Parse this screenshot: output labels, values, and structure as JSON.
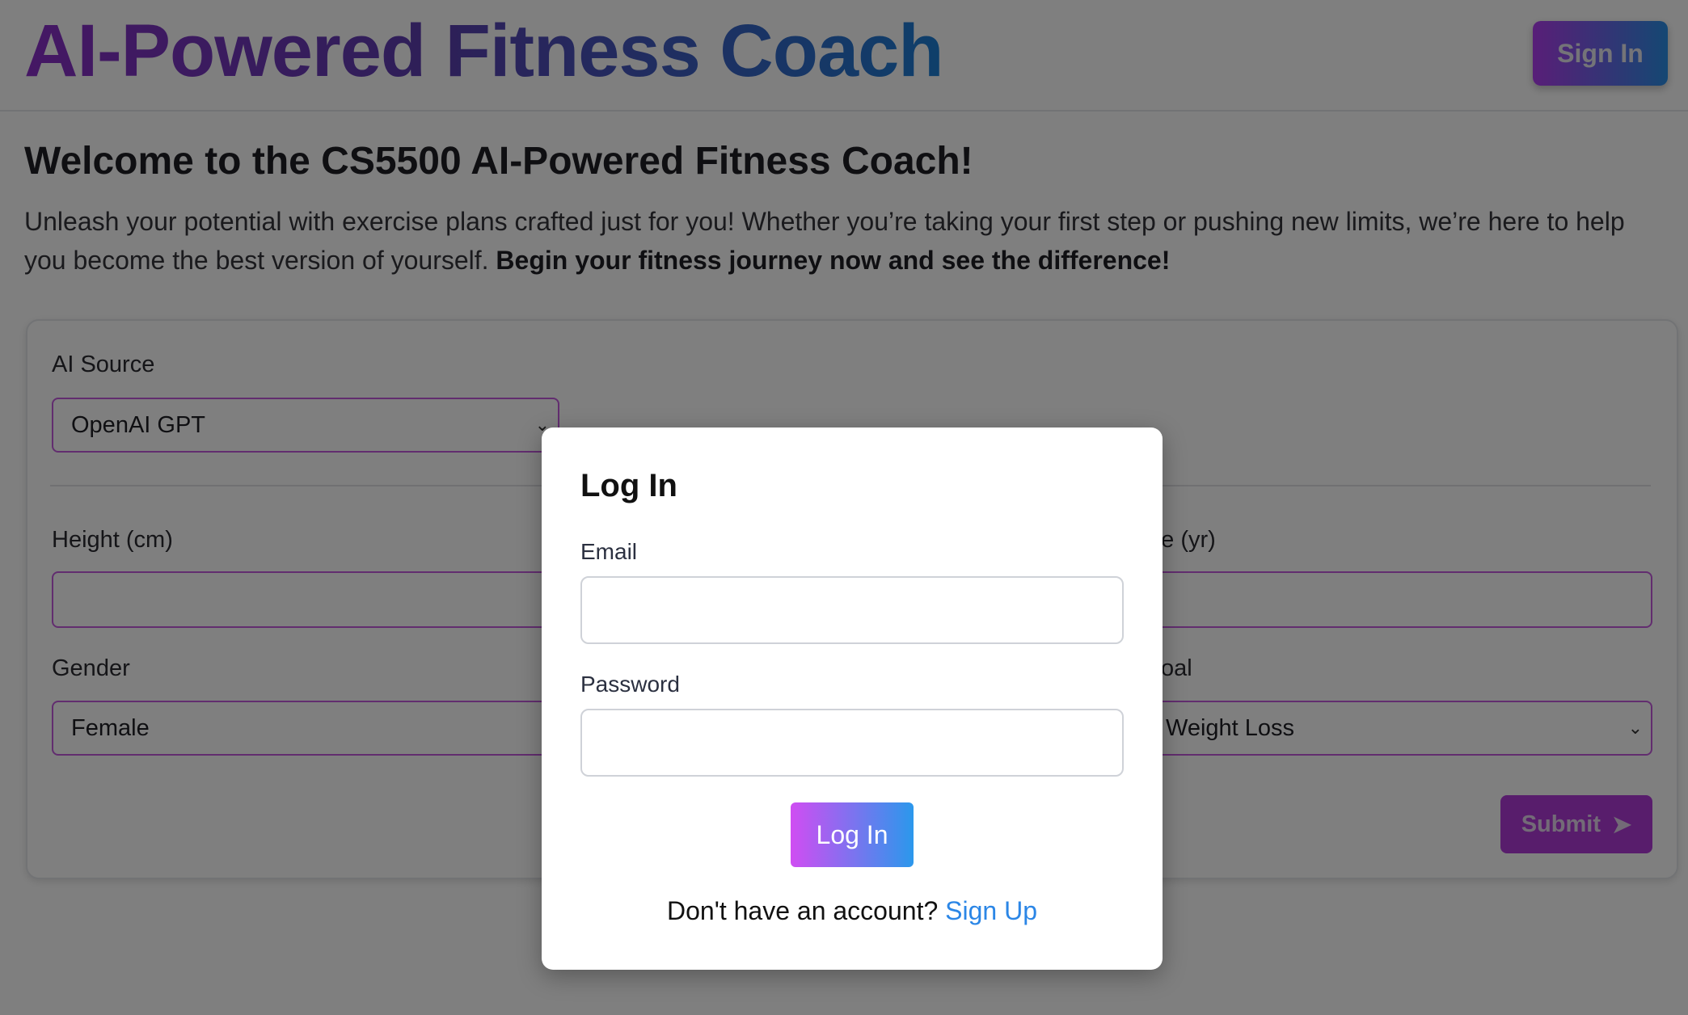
{
  "header": {
    "title": "AI-Powered Fitness Coach",
    "sign_in_label": "Sign In"
  },
  "welcome": {
    "heading": "Welcome to the CS5500 AI-Powered Fitness Coach!",
    "intro_text": "Unleash your potential with exercise plans crafted just for you! Whether you’re taking your first step or pushing new limits, we’re here to help you become the best version of yourself. ",
    "intro_bold": "Begin your fitness journey now and see the difference!"
  },
  "form": {
    "ai_source_label": "AI Source",
    "ai_source_value": "OpenAI GPT",
    "height_label": "Height (cm)",
    "height_value": "",
    "age_label_visible": "ge (yr)",
    "age_value": "",
    "gender_label": "Gender",
    "gender_value": "Female",
    "goal_label_visible": "oal",
    "goal_value": "Weight Loss",
    "submit_label": "Submit"
  },
  "modal": {
    "title": "Log In",
    "email_label": "Email",
    "email_value": "",
    "password_label": "Password",
    "password_value": "",
    "login_button": "Log In",
    "signup_prompt": "Don't have an account? ",
    "signup_link": "Sign Up"
  },
  "colors": {
    "accent_purple": "#b03ad9",
    "link_blue": "#2b86e6"
  }
}
